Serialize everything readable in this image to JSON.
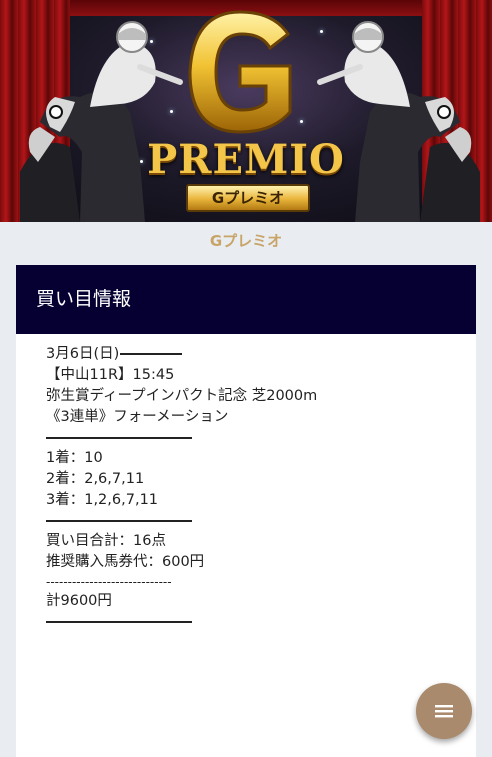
{
  "banner": {
    "logo_text": "PREMIO",
    "plate_text": "Gプレミオ"
  },
  "site": {
    "name": "Gプレミオ"
  },
  "card": {
    "title": "買い目情報",
    "date_line": "3月6日(日)",
    "race_line": "【中山11R】15:45",
    "race_name": "弥生賞ディープインパクト記念 芝2000m",
    "bet_type": "《3連単》フォーメーション",
    "first": "1着：10",
    "second": "2着：2,6,7,11",
    "third": "3着：1,2,6,7,11",
    "total_points": "買い目合計：16点",
    "recommended": "推奨購入馬券代：600円",
    "dashes": "-----------------------------",
    "grand_total": "計9600円"
  },
  "fab": {
    "icon": "menu-icon"
  }
}
